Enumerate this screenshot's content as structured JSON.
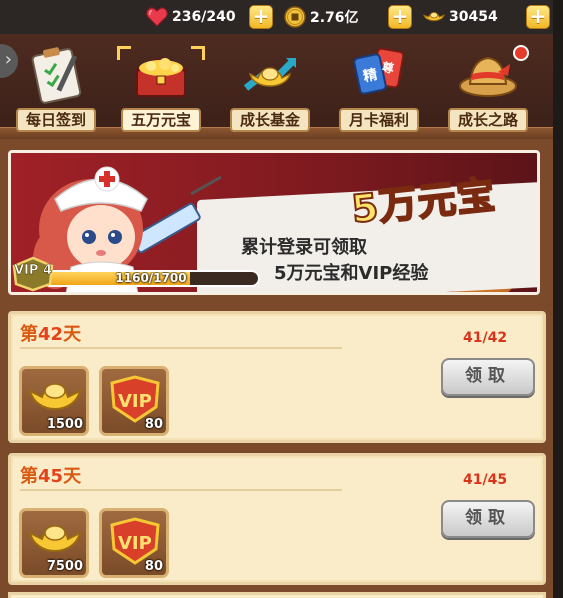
{
  "resources": {
    "stamina": {
      "icon": "heart-icon",
      "value": "236/240"
    },
    "coins": {
      "icon": "coin-icon",
      "value": "2.76亿"
    },
    "ingots": {
      "icon": "gold-ingot-icon",
      "value": "30454"
    }
  },
  "tabs": [
    {
      "label": "每日签到",
      "icon": "checklist-icon"
    },
    {
      "label": "五万元宝",
      "icon": "treasure-chest-icon",
      "active": true
    },
    {
      "label": "成长基金",
      "icon": "gold-chart-icon"
    },
    {
      "label": "月卡福利",
      "icon": "cards-icon"
    },
    {
      "label": "成长之路",
      "icon": "hat-icon"
    }
  ],
  "banner": {
    "title": "5万元宝",
    "line1": "累计登录可领取",
    "line2": "5万元宝和VIP经验",
    "vip_level": "VIP 4",
    "progress_text": "1160/1700",
    "progress_fraction": 0.682
  },
  "rewards": [
    {
      "day_prefix": "第",
      "day_num": "42",
      "day_suffix": "天",
      "count": "41/42",
      "claim_label": "领取",
      "items": [
        {
          "icon": "gold-ingot-icon",
          "qty": "1500"
        },
        {
          "icon": "vip-shield-icon",
          "qty": "80"
        }
      ]
    },
    {
      "day_prefix": "第",
      "day_num": "45",
      "day_suffix": "天",
      "count": "41/45",
      "claim_label": "领取",
      "items": [
        {
          "icon": "gold-ingot-icon",
          "qty": "7500"
        },
        {
          "icon": "vip-shield-icon",
          "qty": "80"
        }
      ]
    }
  ],
  "colors": {
    "accent_orange": "#d95a12",
    "count_red": "#d9331a",
    "gold": "#f3b726",
    "banner_red": "#a02127"
  }
}
